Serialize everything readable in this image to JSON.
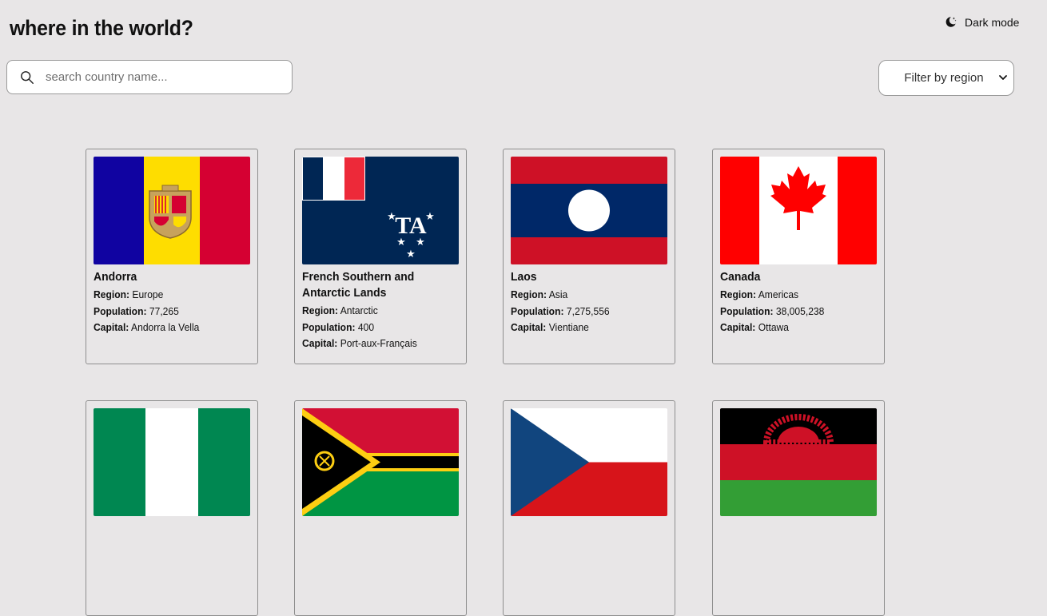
{
  "header": {
    "title": "where in the world?",
    "dark_mode_label": "Dark mode",
    "dark_mode_icon": "moon-icon"
  },
  "search": {
    "placeholder": "search country name...",
    "value": "",
    "icon": "search-icon"
  },
  "filter": {
    "selected": "Filter by region",
    "icon": "chevron-down-icon"
  },
  "labels": {
    "region": "Region:",
    "population": "Population:",
    "capital": "Capital:"
  },
  "countries": [
    {
      "name": "Andorra",
      "region": "Europe",
      "population": "77,265",
      "capital": "Andorra la Vella",
      "flag": "andorra-flag"
    },
    {
      "name": "French Southern and Antarctic Lands",
      "region": "Antarctic",
      "population": "400",
      "capital": "Port-aux-Français",
      "flag": "french-southern-antarctic-lands-flag"
    },
    {
      "name": "Laos",
      "region": "Asia",
      "population": "7,275,556",
      "capital": "Vientiane",
      "flag": "laos-flag"
    },
    {
      "name": "Canada",
      "region": "Americas",
      "population": "38,005,238",
      "capital": "Ottawa",
      "flag": "canada-flag"
    },
    {
      "flag": "nigeria-flag"
    },
    {
      "flag": "vanuatu-flag"
    },
    {
      "flag": "czechia-flag"
    },
    {
      "flag": "malawi-flag"
    }
  ],
  "colors": {
    "background": "#e8e6e7",
    "card_border": "#8e8e8e"
  }
}
